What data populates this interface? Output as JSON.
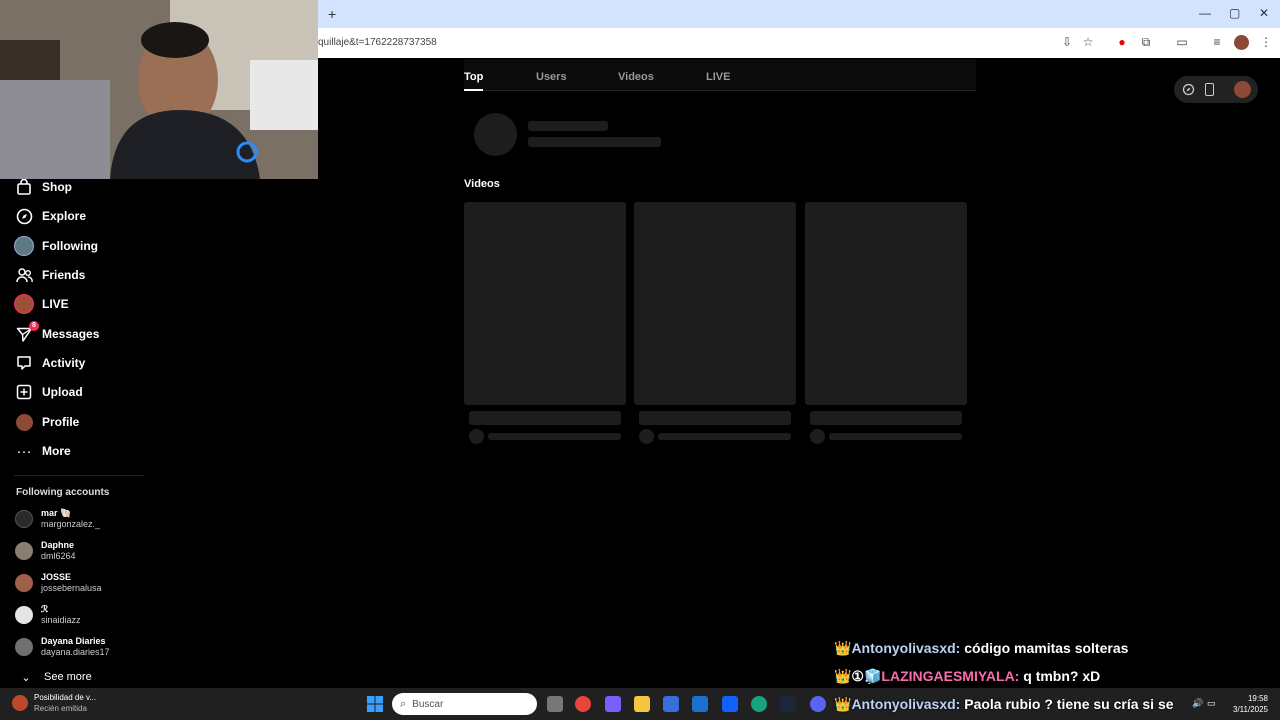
{
  "browser": {
    "new_tab_label": "+",
    "url_fragment": "quillaje&t=1762228737358",
    "window_controls": [
      "—",
      "▢",
      "✕"
    ]
  },
  "sidebar": {
    "items": [
      {
        "label": "Shop",
        "icon": "shop-icon"
      },
      {
        "label": "Explore",
        "icon": "compass-icon"
      },
      {
        "label": "Following",
        "icon": "avatar"
      },
      {
        "label": "Friends",
        "icon": "friends-icon"
      },
      {
        "label": "LIVE",
        "icon": "live-avatar"
      },
      {
        "label": "Messages",
        "icon": "send-icon",
        "badge": "8"
      },
      {
        "label": "Activity",
        "icon": "activity-icon"
      },
      {
        "label": "Upload",
        "icon": "upload-icon"
      },
      {
        "label": "Profile",
        "icon": "avatar"
      },
      {
        "label": "More",
        "icon": "more-icon"
      }
    ],
    "following_title": "Following accounts",
    "accounts": [
      {
        "name": "mar 🐚",
        "username": "margonzalez._"
      },
      {
        "name": "Daphne",
        "username": "dml6264"
      },
      {
        "name": "JOSSE",
        "username": "jossebernalusa"
      },
      {
        "name": "ℛ",
        "username": "sinaidiazz"
      },
      {
        "name": "Dayana Diaries",
        "username": "dayana.diaries17"
      }
    ],
    "see_more": "See more"
  },
  "main": {
    "tabs": [
      "Top",
      "Users",
      "Videos",
      "LIVE"
    ],
    "active_tab": "Top",
    "videos_title": "Videos"
  },
  "chat": [
    {
      "user": "Antonyolivasxd:",
      "msg": "código mamitas solteras",
      "prefix": "👑"
    },
    {
      "user": "LAZINGAESMIYALA:",
      "msg": "q tmbn? xD",
      "prefix": "👑①🧊"
    },
    {
      "user": "Antonyolivasxd:",
      "msg": "Paola rubio ? tiene su cría si se",
      "prefix": "👑"
    }
  ],
  "taskbar": {
    "notif_title": "Posibilidad de v...",
    "notif_sub": "Recién emitida",
    "search_placeholder": "Buscar",
    "time": "19:58",
    "date": "3/11/2025"
  },
  "colors": {
    "background": "#000000",
    "skeleton": "#1d1d1d",
    "accent": "#fe2c55",
    "chrome_tabbar": "#d3e3fd",
    "taskbar": "#202020"
  }
}
